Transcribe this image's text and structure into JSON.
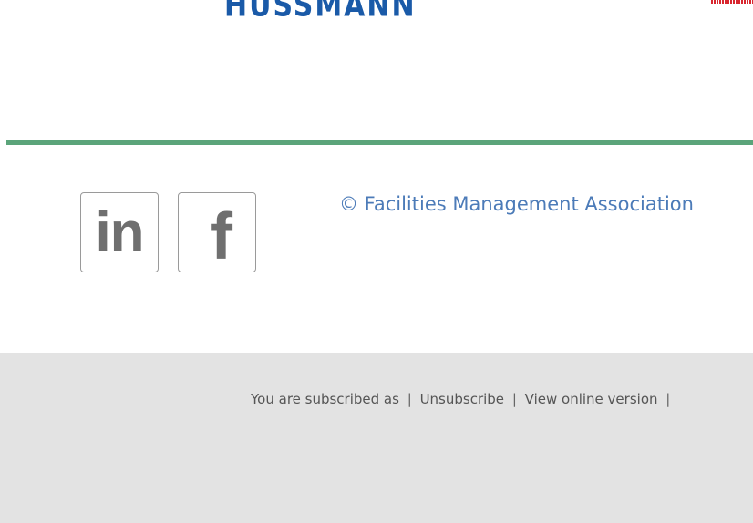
{
  "header": {
    "sponsor_logo_text": "HUSSMANN"
  },
  "social": {
    "linkedin_glyph": "in",
    "facebook_glyph": "f"
  },
  "copyright": {
    "text": "© Facilities Management Association"
  },
  "footer": {
    "subscribed_text": "You are subscribed as",
    "separator": "|",
    "unsubscribe_label": "Unsubscribe",
    "view_online_label": "View online version"
  },
  "colors": {
    "divider": "#5ba47a",
    "copyright_text": "#4c7bb8",
    "footer_background": "#e3e3e3",
    "logo_blue": "#1a5aa8"
  }
}
